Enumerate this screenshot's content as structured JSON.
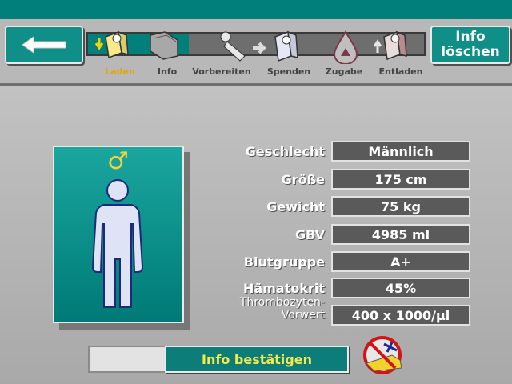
{
  "header": {
    "info_delete_label": "Info\nlöschen",
    "progress_fraction": 0.3,
    "steps": [
      {
        "label": "Laden",
        "icon": "load-bag-icon",
        "active": true
      },
      {
        "label": "Info",
        "icon": "folder-icon",
        "active": false
      },
      {
        "label": "Vorbereiten",
        "icon": "donor-prepare-icon",
        "active": false
      },
      {
        "label": "Spenden",
        "icon": "donate-bag-icon",
        "active": false
      },
      {
        "label": "Zugabe",
        "icon": "additive-drop-icon",
        "active": false
      },
      {
        "label": "Entladen",
        "icon": "unload-bag-icon",
        "active": false
      }
    ]
  },
  "patient": {
    "gender_symbol": "♂",
    "fields": [
      {
        "label": "Geschlecht",
        "value": "Männlich"
      },
      {
        "label": "Größe",
        "value": "175 cm"
      },
      {
        "label": "Gewicht",
        "value": "75 kg"
      },
      {
        "label": "GBV",
        "value": "4985 ml"
      },
      {
        "label": "Blutgruppe",
        "value": "A+"
      },
      {
        "label": "Hämatokrit",
        "value": "45%"
      }
    ],
    "thrombocyte_label": "Thrombozyten-\nVorwert",
    "thrombocyte_value": "400 x 1000/µl"
  },
  "footer": {
    "confirm_label": "Info bestätigen"
  },
  "colors": {
    "teal": "#007f7b",
    "active_step": "#e8a400",
    "confirm_text": "#f6e94a",
    "gender_symbol": "#f2d33a"
  }
}
